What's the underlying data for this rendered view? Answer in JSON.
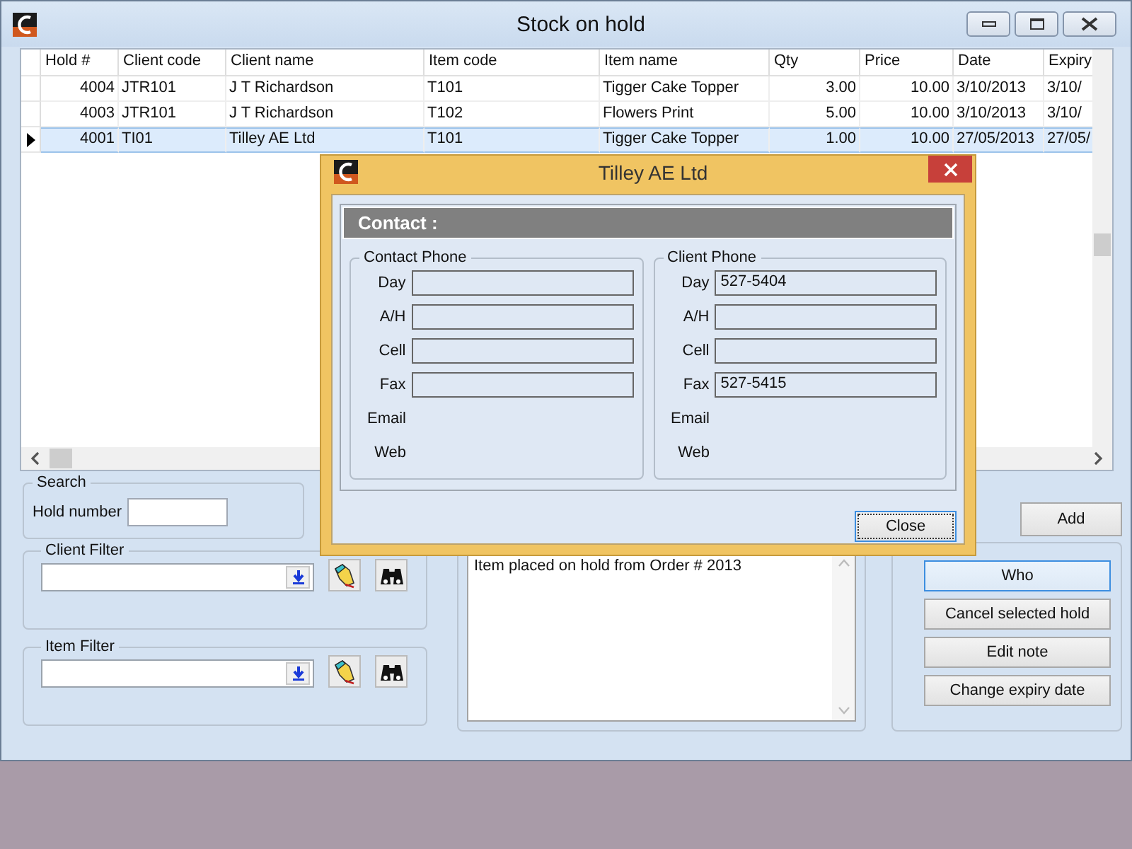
{
  "window": {
    "title": "Stock on hold"
  },
  "table": {
    "columns": [
      {
        "label": "Hold #"
      },
      {
        "label": "Client code"
      },
      {
        "label": "Client name"
      },
      {
        "label": "Item code"
      },
      {
        "label": "Item name"
      },
      {
        "label": "Qty"
      },
      {
        "label": "Price"
      },
      {
        "label": "Date"
      },
      {
        "label": "Expiry"
      }
    ],
    "rows": [
      {
        "selected": false,
        "cells": [
          "4004",
          "JTR101",
          "J T Richardson",
          "T101",
          "Tigger Cake Topper",
          "3.00",
          "10.00",
          "3/10/2013",
          "3/10/"
        ]
      },
      {
        "selected": false,
        "cells": [
          "4003",
          "JTR101",
          "J T Richardson",
          "T102",
          "Flowers Print",
          "5.00",
          "10.00",
          "3/10/2013",
          "3/10/"
        ]
      },
      {
        "selected": true,
        "cells": [
          "4001",
          "TI01",
          "Tilley AE Ltd",
          "T101",
          "Tigger Cake Topper",
          "1.00",
          "10.00",
          "27/05/2013",
          "27/05/"
        ]
      }
    ]
  },
  "search": {
    "title": "Search",
    "label": "Hold number"
  },
  "client_filter": {
    "title": "Client Filter"
  },
  "item_filter": {
    "title": "Item Filter"
  },
  "note": {
    "text": "Item placed on hold from Order # 2013"
  },
  "add_button": "Add",
  "actions": [
    {
      "label": "Who",
      "focused": true
    },
    {
      "label": "Cancel selected hold",
      "focused": false
    },
    {
      "label": "Edit note",
      "focused": false
    },
    {
      "label": "Change expiry date",
      "focused": false
    }
  ],
  "dialog": {
    "title": "Tilley AE Ltd",
    "header": "Contact :",
    "groups": [
      {
        "title": "Contact Phone",
        "fields": [
          {
            "label": "Day",
            "kind": "field"
          },
          {
            "label": "A/H",
            "kind": "field"
          },
          {
            "label": "Cell",
            "kind": "field"
          },
          {
            "label": "Fax",
            "kind": "field"
          },
          {
            "label": "Email",
            "kind": "text"
          },
          {
            "label": "Web",
            "kind": "text"
          }
        ]
      },
      {
        "title": "Client Phone",
        "fields": [
          {
            "label": "Day",
            "kind": "field",
            "value": "527-5404"
          },
          {
            "label": "A/H",
            "kind": "field"
          },
          {
            "label": "Cell",
            "kind": "field"
          },
          {
            "label": "Fax",
            "kind": "field",
            "value": "527-5415"
          },
          {
            "label": "Email",
            "kind": "text"
          },
          {
            "label": "Web",
            "kind": "text"
          }
        ]
      }
    ],
    "close_button": "Close"
  }
}
